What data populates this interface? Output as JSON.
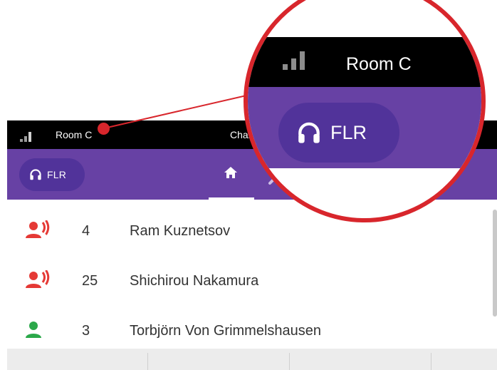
{
  "status_bar": {
    "room": "Room C",
    "chair_partial": "Chair"
  },
  "toolbar": {
    "language_chip": "FLR",
    "language_icon": "headphones-icon",
    "tabs": [
      {
        "icon": "home-icon",
        "selected": true
      },
      {
        "icon": "settings-icon",
        "selected": false
      }
    ]
  },
  "participants": [
    {
      "icon": "speaking-person-icon",
      "icon_color": "#e53935",
      "number": "4",
      "name": "Ram Kuznetsov"
    },
    {
      "icon": "speaking-person-icon",
      "icon_color": "#e53935",
      "number": "25",
      "name": "Shichirou Nakamura"
    },
    {
      "icon": "person-icon",
      "icon_color": "#2ba84a",
      "number": "3",
      "name": "Torbjörn Von Grimmelshausen"
    }
  ],
  "callout": {
    "room": "Room C",
    "language_chip": "FLR",
    "ring_color": "#d8262c"
  },
  "colors": {
    "toolbar": "#6741a4",
    "chip": "#51339a",
    "status_bar": "#000000"
  }
}
